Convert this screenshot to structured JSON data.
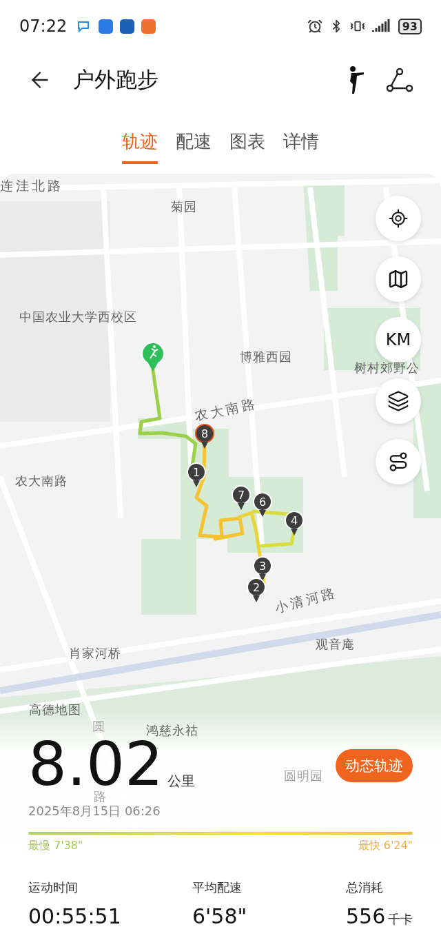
{
  "status_bar": {
    "time": "07:22",
    "battery": "93"
  },
  "header": {
    "title": "户外跑步"
  },
  "tabs": [
    {
      "label": "轨迹",
      "selected": true
    },
    {
      "label": "配速",
      "selected": false
    },
    {
      "label": "图表",
      "selected": false
    },
    {
      "label": "详情",
      "selected": false
    }
  ],
  "map": {
    "labels": [
      {
        "text": "连洼北路",
        "kind": "road"
      },
      {
        "text": "菊园",
        "kind": "place"
      },
      {
        "text": "中国农业大学西校区",
        "kind": "place"
      },
      {
        "text": "博雅西园",
        "kind": "place"
      },
      {
        "text": "树村郊野公",
        "kind": "place"
      },
      {
        "text": "农大南路",
        "kind": "road"
      },
      {
        "text": "农大南路",
        "kind": "place"
      },
      {
        "text": "小清河路",
        "kind": "road"
      },
      {
        "text": "肖家河桥",
        "kind": "place"
      },
      {
        "text": "观音庵",
        "kind": "place"
      },
      {
        "text": "鸿慈永祜",
        "kind": "place"
      },
      {
        "text": "圆明园",
        "kind": "faded"
      },
      {
        "text": "圆",
        "kind": "faded"
      },
      {
        "text": "路",
        "kind": "faded"
      }
    ],
    "attribution": "高德地图",
    "markers": [
      {
        "label": "8",
        "kind": "end"
      },
      {
        "label": "1",
        "kind": "split"
      },
      {
        "label": "7",
        "kind": "split"
      },
      {
        "label": "6",
        "kind": "split"
      },
      {
        "label": "4",
        "kind": "split"
      },
      {
        "label": "3",
        "kind": "split"
      },
      {
        "label": "2",
        "kind": "split"
      }
    ],
    "unit_button": "KM"
  },
  "summary": {
    "distance": "8.02",
    "unit": "公里",
    "replay_button": "动态轨迹",
    "date": "2025年8月15日 06:26",
    "slowest": "最慢 7'38\"",
    "fastest": "最快 6'24\"",
    "stats": [
      {
        "label": "运动时间",
        "value": "00:55:51"
      },
      {
        "label": "平均配速",
        "value": "6'58\""
      },
      {
        "label": "总消耗",
        "value": "556",
        "unit": "千卡"
      }
    ]
  }
}
